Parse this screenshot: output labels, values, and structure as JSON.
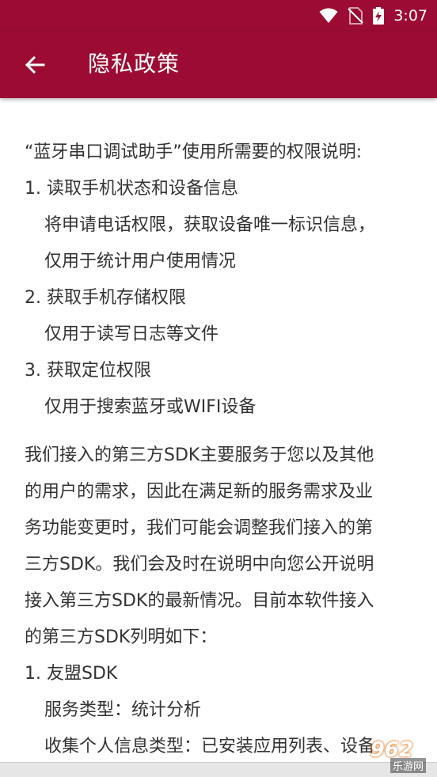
{
  "status_bar": {
    "time": "3:07",
    "icons": [
      "wifi-icon",
      "no-sim-icon",
      "battery-charging-icon"
    ]
  },
  "app_bar": {
    "back_icon": "arrow-left-icon",
    "title": "隐私政策"
  },
  "colors": {
    "header": "#9c0c32",
    "text": "#333333",
    "background": "#ffffff"
  },
  "content": {
    "intro": "“蓝牙串口调试助手”使用所需要的权限说明:",
    "permissions": [
      {
        "title": "1. 读取手机状态和设备信息",
        "desc": [
          "将申请电话权限，获取设备唯一标识信息，",
          "仅用于统计用户使用情况"
        ]
      },
      {
        "title": "2. 获取手机存储权限",
        "desc": [
          "仅用于读写日志等文件"
        ]
      },
      {
        "title": "3. 获取定位权限",
        "desc": [
          "仅用于搜索蓝牙或WIFI设备"
        ]
      }
    ],
    "sdk_paragraph": [
      "我们接入的第三方SDK主要服务于您以及其他",
      "的用户的需求，因此在满足新的服务需求及业",
      "务功能变更时，我们可能会调整我们接入的第",
      "三方SDK。我们会及时在说明中向您公开说明",
      "接入第三方SDK的最新情况。目前本软件接入",
      "的第三方SDK列明如下："
    ],
    "sdk_list": [
      {
        "title": "1. 友盟SDK",
        "service_type": "服务类型：统计分析",
        "info_type": "收集个人信息类型：已安装应用列表、设备"
      }
    ]
  },
  "watermark": {
    "text": "962",
    "sub": "乐游网"
  }
}
